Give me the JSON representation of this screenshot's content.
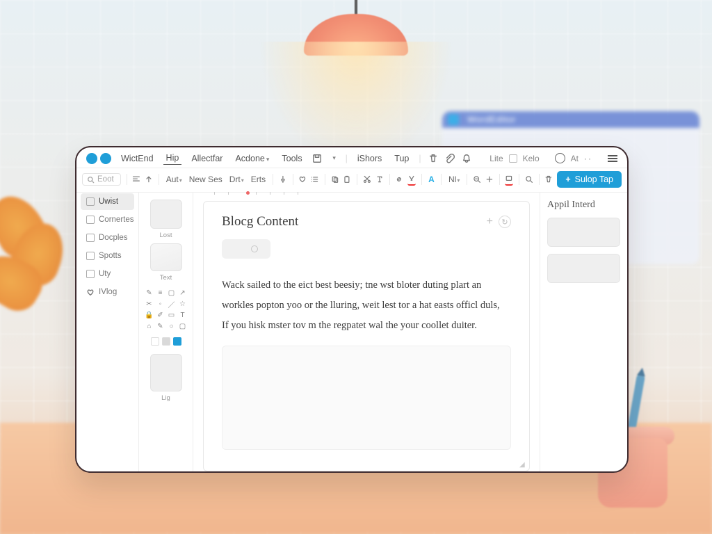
{
  "background_window": {
    "title": "WordEditor"
  },
  "menubar": {
    "items": [
      "WictEnd",
      "Hip",
      "Allectfar",
      "Acdone",
      "Tools",
      "iShors",
      "Tup"
    ],
    "right_status": [
      "Lite",
      "Kelo"
    ],
    "right_at": "At"
  },
  "toolbar": {
    "search_placeholder": "Eoot",
    "labels": {
      "aut": "Aut",
      "new_ses": "New Ses",
      "drt": "Drt",
      "erts": "Erts",
      "nl": "Nl"
    },
    "primary_button": "Sulop Tap"
  },
  "sidebar": {
    "items": [
      {
        "label": "Uwist",
        "active": true
      },
      {
        "label": "Cornertes",
        "active": false
      },
      {
        "label": "Docples",
        "active": false
      },
      {
        "label": "Spotts",
        "active": false
      },
      {
        "label": "Uty",
        "active": false
      },
      {
        "label": "IVlog",
        "active": false
      }
    ]
  },
  "palette": {
    "thumb1_label": "Lost",
    "thumb2_label": "Text",
    "thumb3_label": "Lig"
  },
  "document": {
    "title": "Blocg Content",
    "body_line1": "Wack sailed to the eict best beesiy; tne wst bloter duting plart an",
    "body_line2": "workles popton yoo or the lluring, weit lest tor a hat easts officl duls,",
    "body_line3": "If you hisk mster tov m the regpatet wal the your coollet duiter."
  },
  "properties": {
    "title": "Appil Interd"
  },
  "colors": {
    "accent": "#1f9ed8"
  }
}
